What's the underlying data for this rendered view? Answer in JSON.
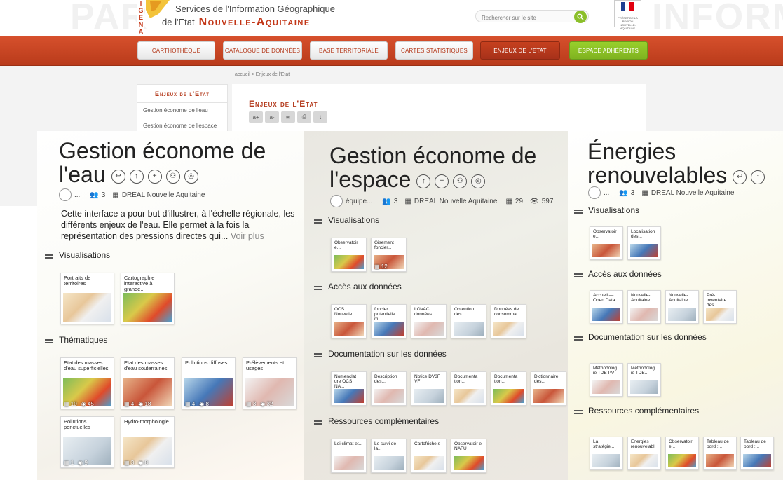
{
  "header": {
    "title_line1": "Services de l'Information Géographique",
    "title_line2_prefix": "de l'Etat",
    "title_line2_region": "Nouvelle-Aquitaine",
    "logo_letters": "I G E N A",
    "search_placeholder": "Rechercher sur le site",
    "watermark_left": "PAR",
    "watermark_right": "INFORM"
  },
  "nav": [
    {
      "label": "Carthothèque"
    },
    {
      "label": "Catalogue de données"
    },
    {
      "label": "Base territoriale"
    },
    {
      "label": "Cartes statistiques"
    },
    {
      "label": "Enjeux de l'Etat"
    },
    {
      "label": "Espace adhérents"
    }
  ],
  "breadcrumb": "accueil > Enjeux de l'Etat",
  "sidebar": {
    "heading": "Enjeux de l'Etat",
    "items": [
      "Gestion économe de l'eau",
      "Gestion économe de l'espace"
    ]
  },
  "main": {
    "title": "Enjeux de l'Etat",
    "tools": [
      "a+",
      "a-",
      "✉",
      "⎙",
      "t"
    ]
  },
  "panels": [
    {
      "title_line1": "Gestion économe de",
      "title_line2": "l'eau",
      "meta": {
        "author": "...",
        "members": "3",
        "org": "DREAL Nouvelle Aquitaine"
      },
      "description": "Cette interface a pour but d'illustrer, à l'échelle régionale, les différents enjeux de l'eau. Elle permet à la fois la représentation des pressions directes qui...",
      "more": "Voir plus",
      "sections": [
        {
          "label": "Visualisations",
          "cards": [
            {
              "title": "Portraits de territoires"
            },
            {
              "title": "Cartographie interactive à grande..."
            }
          ]
        },
        {
          "label": "Thématiques",
          "cards": [
            {
              "title": "Etat des masses d'eau superficielles",
              "a": "10",
              "b": "45"
            },
            {
              "title": "Etat des masses d'eau souterraines",
              "a": "4",
              "b": "18"
            },
            {
              "title": "Pollutions diffuses",
              "a": "4",
              "b": "8"
            },
            {
              "title": "Prélèvements et usages",
              "a": "3",
              "b": "32"
            },
            {
              "title": "Pollutions ponctuelles",
              "a": "1",
              "b": "9"
            },
            {
              "title": "Hydro-morphologie",
              "a": "3",
              "b": "8"
            }
          ]
        }
      ]
    },
    {
      "title_line1": "Gestion économe de",
      "title_line2": "l'espace",
      "meta": {
        "author": "équipe...",
        "members": "3",
        "org": "DREAL Nouvelle Aquitaine",
        "datasets": "29",
        "views": "597"
      },
      "sections": [
        {
          "label": "Visualisations",
          "cards": [
            {
              "title": "Observatoir e..."
            },
            {
              "title": "Gisement foncier...",
              "a": "12"
            }
          ]
        },
        {
          "label": "Accès aux données",
          "cards": [
            {
              "title": "OCS Nouvelle..."
            },
            {
              "title": "foncier potentielle m..."
            },
            {
              "title": "LOVAC, données..."
            },
            {
              "title": "Obtention des..."
            },
            {
              "title": "Données de consommat ..."
            }
          ]
        },
        {
          "label": "Documentation sur les données",
          "cards": [
            {
              "title": "Nomenclat ure OCS NA..."
            },
            {
              "title": "Description des..."
            },
            {
              "title": "Notice DV3F VF"
            },
            {
              "title": "Documenta tion..."
            },
            {
              "title": "Documenta tion..."
            },
            {
              "title": "Dictionnaire des..."
            }
          ]
        },
        {
          "label": "Ressources complémentaires",
          "cards": [
            {
              "title": "Loi climat et..."
            },
            {
              "title": "Le suivi de la..."
            },
            {
              "title": "Cartofriche s"
            },
            {
              "title": "Observatoir e NAFU"
            }
          ]
        }
      ]
    },
    {
      "title_line1": "Énergies",
      "title_line2": "renouvelables",
      "meta": {
        "author": "...",
        "members": "3",
        "org": "DREAL Nouvelle Aquitaine"
      },
      "sections": [
        {
          "label": "Visualisations",
          "cards": [
            {
              "title": "Observatoir e..."
            },
            {
              "title": "Localisation des..."
            }
          ]
        },
        {
          "label": "Accès aux données",
          "cards": [
            {
              "title": "Accueil — Open Data..."
            },
            {
              "title": "Nouvelle-Aquitaine..."
            },
            {
              "title": "Nouvelle-Aquitaine..."
            },
            {
              "title": "Pré-inventaire des..."
            }
          ]
        },
        {
          "label": "Documentation sur les données",
          "cards": [
            {
              "title": "Méthodolog ie TDB PV"
            },
            {
              "title": "Méthodolog ie TDB..."
            }
          ]
        },
        {
          "label": "Ressources complémentaires",
          "cards": [
            {
              "title": "La stratégie..."
            },
            {
              "title": "Energies renouvelabl"
            },
            {
              "title": "Observatoir e..."
            },
            {
              "title": "Tableau de bord :..."
            },
            {
              "title": "Tableau de bord :..."
            }
          ]
        }
      ]
    }
  ],
  "colors": {
    "brand_red": "#c23516",
    "nav_green": "#8bbf2a"
  }
}
